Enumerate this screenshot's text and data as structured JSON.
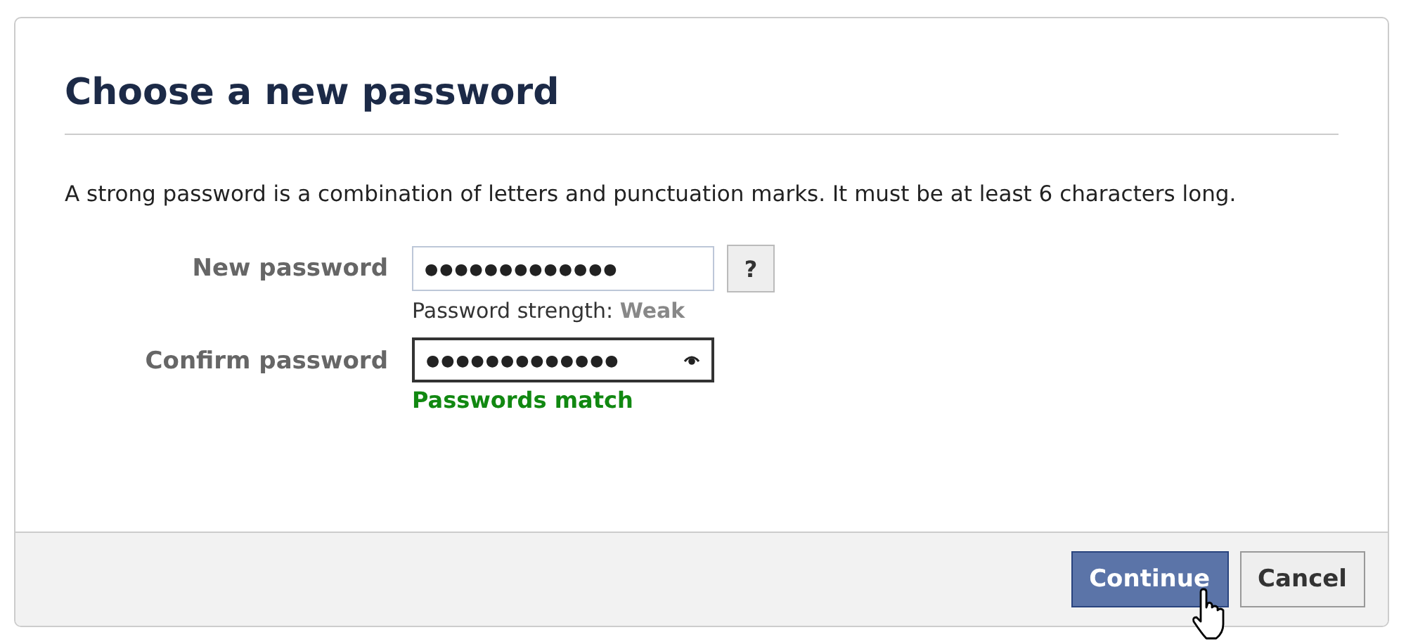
{
  "dialog": {
    "title": "Choose a new password",
    "description": "A strong password is a combination of letters and punctuation marks. It must be at least 6 characters long."
  },
  "fields": [
    {
      "label": "New password",
      "value": "●●●●●●●●●●●●●",
      "focused": false,
      "help_button": "?",
      "hint_label": "Password strength:",
      "hint_value": "Weak",
      "kind": "strength"
    },
    {
      "label": "Confirm password",
      "value": "●●●●●●●●●●●●●",
      "focused": true,
      "reveal_icon": true,
      "hint_value": "Passwords match",
      "kind": "match"
    }
  ],
  "buttons": [
    {
      "label": "Continue",
      "kind": "primary"
    },
    {
      "label": "Cancel",
      "kind": "secondary"
    }
  ]
}
